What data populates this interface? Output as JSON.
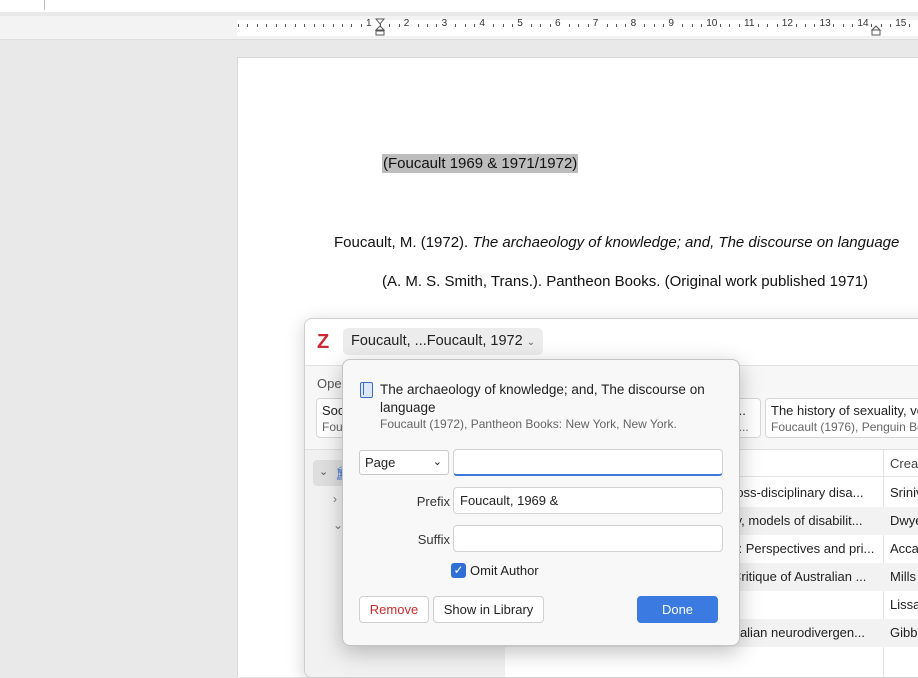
{
  "document": {
    "inline_citation": "(Foucault 1969 & 1971/1972)",
    "reference_line1_author": "Foucault, M. (1972). ",
    "reference_line1_title": "The archaeology of knowledge; and, The discourse on language",
    "reference_line2": "(A. M. S. Smith, Trans.). Pantheon Books. (Original work published 1971)"
  },
  "ruler": {
    "numbers": [
      "1",
      "2",
      "3",
      "4",
      "5",
      "6",
      "7",
      "8",
      "9",
      "10",
      "11",
      "12",
      "13",
      "14",
      "15"
    ]
  },
  "zotero": {
    "logo": "Z",
    "citation_pill": "Foucault, ...Foucault, 1972",
    "open_label": "Ope",
    "cards": [
      {
        "title": "Soc",
        "sub": "Fou"
      },
      {
        "title": "...",
        "sub": "U..."
      },
      {
        "title": "The history of sexuality, vo",
        "sub": "Foucault (1976), Penguin Boo"
      }
    ],
    "table_header_creator": "Creat",
    "rows": [
      {
        "title": "ross-disciplinary disa...",
        "creator": "Sriniv"
      },
      {
        "title": "ty, models of disabilit...",
        "creator": "Dwye"
      },
      {
        "title": "s: Perspectives and pri...",
        "creator": "Acca"
      },
      {
        "title": "Critique of Australian ...",
        "creator": "Mills"
      },
      {
        "title": "",
        "creator": "Lissa"
      },
      {
        "title": "tralian neurodivergen...",
        "creator": "Gibb"
      }
    ]
  },
  "popup": {
    "item_title": "The archaeology of knowledge; and, The discourse on language",
    "item_sub": "Foucault (1972), Pantheon Books: New York, New York.",
    "locator_label": "Page",
    "locator_value": "",
    "prefix_label": "Prefix",
    "prefix_value": "Foucault, 1969 &",
    "suffix_label": "Suffix",
    "suffix_value": "",
    "omit_author_label": "Omit Author",
    "omit_author_checked": true,
    "remove_label": "Remove",
    "show_label": "Show in Library",
    "done_label": "Done"
  },
  "colors": {
    "zotero_red": "#cc2936",
    "accent_blue": "#3b7ae0",
    "remove_red": "#cc2a2a"
  }
}
